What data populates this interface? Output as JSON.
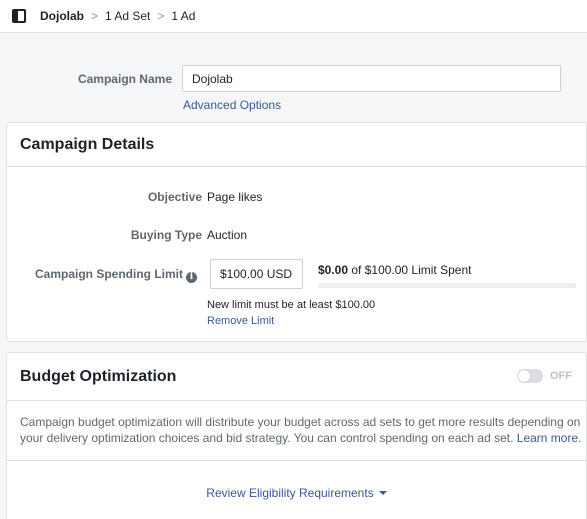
{
  "breadcrumb": {
    "items": [
      "Dojolab",
      "1 Ad Set",
      "1 Ad"
    ],
    "separator": ">"
  },
  "campaign_name": {
    "label": "Campaign Name",
    "value": "Dojolab",
    "advanced_options": "Advanced Options"
  },
  "campaign_details": {
    "title": "Campaign Details",
    "objective_label": "Objective",
    "objective_value": "Page likes",
    "buying_type_label": "Buying Type",
    "buying_type_value": "Auction",
    "spending_limit_label": "Campaign Spending Limit",
    "spending_limit_value": "$100.00 USD",
    "spent_amount": "$0.00",
    "spent_suffix": "of $100.00 Limit Spent",
    "spent_fraction": 0,
    "limit_hint": "New limit must be at least $100.00",
    "remove_limit": "Remove Limit"
  },
  "budget_optimization": {
    "title": "Budget Optimization",
    "toggle_state": "OFF",
    "description": "Campaign budget optimization will distribute your budget across ad sets to get more results depending on your delivery optimization choices and bid strategy. You can control spending on each ad set.",
    "learn_more": "Learn more.",
    "review_link": "Review Eligibility Requirements"
  },
  "colors": {
    "link": "#385898",
    "background": "#f5f6f7",
    "border": "#dddfe2"
  }
}
